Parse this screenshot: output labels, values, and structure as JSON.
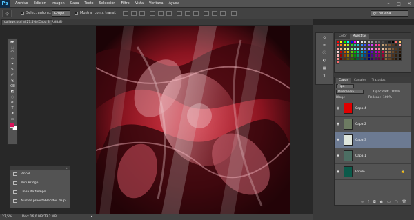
{
  "app": {
    "logo": "Ps"
  },
  "menu": [
    "Archivo",
    "Edición",
    "Imagen",
    "Capa",
    "Texto",
    "Selección",
    "Filtro",
    "Vista",
    "Ventana",
    "Ayuda"
  ],
  "window_controls": [
    "–",
    "□",
    "✕"
  ],
  "options_bar": {
    "tool_icon": "move-tool-icon",
    "auto_select_label": "Selec. autom.:",
    "group_value": "Grupo",
    "show_transform_label": "Mostrar contr. transf.",
    "workspace_value": "gif prueba"
  },
  "document": {
    "tab_label": "collage.psd al 27,5% (Capa 3, RGB/8)"
  },
  "toolbox": {
    "tools": [
      "▸▸",
      "⬚",
      "⌒",
      "⊹",
      "⌖",
      "✎",
      "✐",
      "⎘",
      "⌫",
      "◩",
      "◌",
      "✒",
      "T",
      "⬈",
      "▭",
      "✋",
      "🔍"
    ],
    "foreground_color": "#d8135a",
    "background_color": "#ffffff"
  },
  "flyout": {
    "items": [
      {
        "label": "Pincel",
        "icon": "brush-panel-icon"
      },
      {
        "label": "Mini Bridge",
        "icon": "mini-bridge-icon"
      },
      {
        "label": "Línea de tiempo",
        "icon": "timeline-icon"
      },
      {
        "label": "Ajustes preestablecidos de pi...",
        "icon": "brush-presets-icon"
      }
    ]
  },
  "status": {
    "zoom": "27,5%",
    "doc_info": "Doc: 16,0 MB/73,2 MB"
  },
  "swatches_panel": {
    "tabs": [
      "Color",
      "Muestras"
    ],
    "active_tab": "Muestras",
    "colors": [
      "#ff0000",
      "#ffff00",
      "#00ff00",
      "#00ffff",
      "#0000ff",
      "#ff00ff",
      "#ffffff",
      "#e6e6e6",
      "#cccccc",
      "#b3b3b3",
      "#999999",
      "#808080",
      "#666666",
      "#4d4d4d",
      "#333333",
      "#1a1a1a",
      "#000000",
      "#ff6666",
      "#ffcc66",
      "#ff3b3b",
      "#ff7b22",
      "#ffd41c",
      "#a8ef1d",
      "#2bd62b",
      "#1dc99c",
      "#1dbfd6",
      "#2b8cff",
      "#3b4dff",
      "#8c3bff",
      "#d63bff",
      "#ff3bbd",
      "#ff3b7b",
      "#c2a37a",
      "#9c7a55",
      "#7a5433",
      "#5c3a1d",
      "#3b2412",
      "#ffa3a3",
      "#ff9999",
      "#ffb380",
      "#ffe680",
      "#ccff80",
      "#80ff80",
      "#80ffd9",
      "#80f2ff",
      "#80bfff",
      "#8080ff",
      "#bf80ff",
      "#ff80f2",
      "#ff80bf",
      "#ff8099",
      "#e6c2a3",
      "#c29c7a",
      "#9c7a55",
      "#7a5c3b",
      "#5c3b1d",
      "#40260d",
      "#ffd9d9",
      "#cc0000",
      "#cc5200",
      "#ccaa00",
      "#66cc00",
      "#00cc00",
      "#00cc88",
      "#00aacc",
      "#0066cc",
      "#0000cc",
      "#6600cc",
      "#aa00cc",
      "#cc0088",
      "#cc0044",
      "#b38f66",
      "#8f6b47",
      "#6b4a2b",
      "#4a2e14",
      "#2b1707",
      "#ffb3b3",
      "#990000",
      "#993d00",
      "#997f00",
      "#4d9900",
      "#009900",
      "#009966",
      "#007f99",
      "#004d99",
      "#000099",
      "#4d0099",
      "#7f0099",
      "#990066",
      "#990033",
      "#a37a4d",
      "#7a5233",
      "#52331a",
      "#33200d",
      "#1a0d00",
      "#ff8c8c",
      "#660000",
      "#662900",
      "#665500",
      "#336600",
      "#006600",
      "#006644",
      "#005566",
      "#003366",
      "#000066",
      "#330066",
      "#550066",
      "#660044",
      "#660022",
      "#8f6633",
      "#664422",
      "#442a11",
      "#2a1808",
      "#150a00",
      "#ff6b6b"
    ]
  },
  "layers_panel": {
    "tabs": [
      "Capas",
      "Canales",
      "Trazados"
    ],
    "active_tab": "Capas",
    "filter_label": "Tipo",
    "blend_mode": "Diferencia",
    "opacity_label": "Opacidad:",
    "opacity_value": "100%",
    "lock_label": "Bloq.:",
    "fill_label": "Relleno:",
    "fill_value": "100%",
    "layers": [
      {
        "name": "Capa 4",
        "thumb": "#e00000",
        "selected": false,
        "locked": false
      },
      {
        "name": "Capa 2",
        "thumb": "#6d7b62",
        "selected": false,
        "locked": false
      },
      {
        "name": "Capa 3",
        "thumb": "#dfe6dc",
        "selected": true,
        "locked": false
      },
      {
        "name": "Capa 1",
        "thumb": "#4c6e63",
        "selected": false,
        "locked": false
      },
      {
        "name": "Fondo",
        "thumb": "#0b5a4a",
        "selected": false,
        "locked": true
      }
    ],
    "bottom_icons": [
      "link-layers-icon",
      "fx-icon",
      "mask-icon",
      "adjustment-icon",
      "group-icon",
      "new-layer-icon",
      "trash-icon"
    ]
  }
}
